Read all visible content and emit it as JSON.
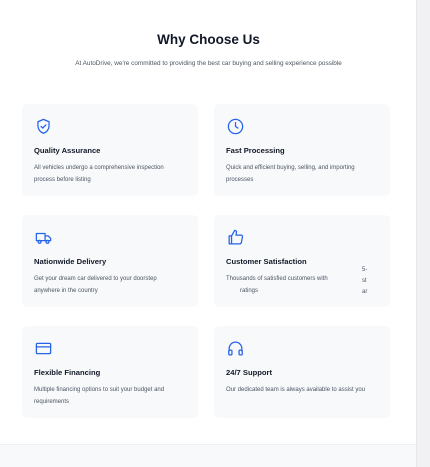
{
  "section": {
    "title": "Why Choose Us",
    "subtitle": "At AutoDrive, we're committed to providing the best car buying and selling experience possible"
  },
  "features": [
    {
      "icon": "shield-check-icon",
      "title": "Quality Assurance",
      "desc": "All vehicles undergo a comprehensive inspection process before listing"
    },
    {
      "icon": "clock-icon",
      "title": "Fast Processing",
      "desc": "Quick and efficient buying, selling, and importing processes"
    },
    {
      "icon": "truck-icon",
      "title": "Nationwide Delivery",
      "desc": "Get your dream car delivered to your doorstep anywhere in the country"
    },
    {
      "icon": "thumbs-up-icon",
      "title": "Customer Satisfaction",
      "desc_line1": "Thousands of satisfied customers with",
      "desc_line2": "ratings",
      "side_fragments": [
        "5-",
        "st",
        "ar"
      ]
    },
    {
      "icon": "credit-card-icon",
      "title": "Flexible Financing",
      "desc": "Multiple financing options to suit your budget and requirements"
    },
    {
      "icon": "headphones-icon",
      "title": "24/7 Support",
      "desc": "Our dedicated team is always available to assist you"
    }
  ],
  "colors": {
    "accent": "#2563eb",
    "card_bg": "#f8f9fb",
    "text": "#111827",
    "muted": "#4b5563"
  }
}
